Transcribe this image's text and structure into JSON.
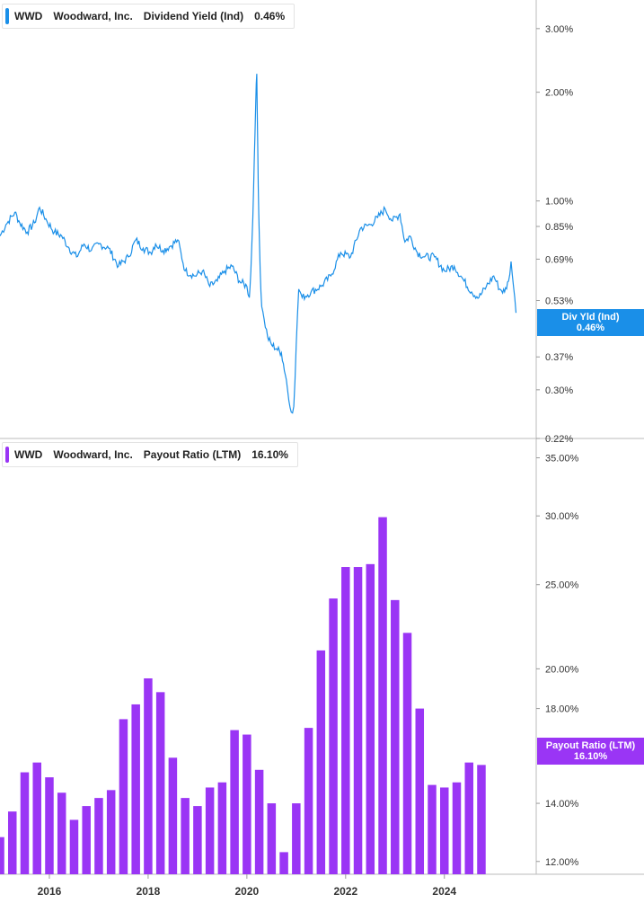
{
  "colors": {
    "yield": "#1a8fe8",
    "payout": "#9a35f5",
    "grid_axis": "#bbbbbb"
  },
  "panels": [
    {
      "legend": {
        "ticker": "WWD",
        "company": "Woodward, Inc.",
        "metric": "Dividend Yield (Ind)",
        "value": "0.46%"
      },
      "flag": {
        "label": "Div Yld (Ind)",
        "value": "0.46%"
      }
    },
    {
      "legend": {
        "ticker": "WWD",
        "company": "Woodward, Inc.",
        "metric": "Payout Ratio (LTM)",
        "value": "16.10%"
      },
      "flag": {
        "label": "Payout Ratio (LTM)",
        "value": "16.10%"
      }
    }
  ],
  "chart_data": [
    {
      "type": "line",
      "scale": "log",
      "ylim": [
        0.22,
        3.6
      ],
      "yticks": [
        3.0,
        2.0,
        1.0,
        0.85,
        0.69,
        0.53,
        0.37,
        0.3,
        0.22
      ],
      "ytick_labels": [
        "3.00%",
        "2.00%",
        "1.00%",
        "0.85%",
        "0.69%",
        "0.53%",
        "0.37%",
        "0.30%",
        "0.22%"
      ],
      "series": [
        {
          "x": [
            2015.0,
            2015.12,
            2015.3,
            2015.4,
            2015.55,
            2015.7,
            2015.8,
            2015.95,
            2016.1,
            2016.25,
            2016.4,
            2016.55,
            2016.7,
            2016.85,
            2017.0,
            2017.2,
            2017.4,
            2017.6,
            2017.75,
            2017.9,
            2018.05,
            2018.15,
            2018.3,
            2018.45,
            2018.6,
            2018.75,
            2018.95,
            2019.1,
            2019.25,
            2019.4,
            2019.55,
            2019.7,
            2019.85,
            2020.0,
            2020.05,
            2020.08,
            2020.12,
            2020.15,
            2020.18,
            2020.2,
            2020.22,
            2020.24,
            2020.27,
            2020.3,
            2020.35,
            2020.42,
            2020.5,
            2020.6,
            2020.7,
            2020.8,
            2020.85,
            2020.9,
            2020.95,
            2021.0,
            2021.05,
            2021.08,
            2021.12,
            2021.3,
            2021.5,
            2021.7,
            2021.9,
            2022.1,
            2022.3,
            2022.5,
            2022.65,
            2022.8,
            2022.95,
            2023.1,
            2023.2,
            2023.3,
            2023.45,
            2023.6,
            2023.8,
            2024.0,
            2024.2,
            2024.4,
            2024.55,
            2024.7,
            2024.85,
            2025.0,
            2025.12,
            2025.22,
            2025.3,
            2025.35,
            2025.4,
            2025.45
          ],
          "y": [
            0.8,
            0.86,
            0.93,
            0.87,
            0.82,
            0.87,
            0.96,
            0.88,
            0.82,
            0.8,
            0.74,
            0.7,
            0.76,
            0.73,
            0.76,
            0.74,
            0.66,
            0.7,
            0.78,
            0.74,
            0.72,
            0.76,
            0.73,
            0.75,
            0.78,
            0.64,
            0.62,
            0.64,
            0.58,
            0.6,
            0.64,
            0.66,
            0.6,
            0.58,
            0.54,
            0.64,
            0.9,
            1.3,
            1.9,
            2.25,
            1.4,
            0.92,
            0.64,
            0.51,
            0.47,
            0.42,
            0.4,
            0.39,
            0.38,
            0.32,
            0.28,
            0.26,
            0.27,
            0.4,
            0.57,
            0.56,
            0.54,
            0.56,
            0.58,
            0.62,
            0.72,
            0.7,
            0.84,
            0.86,
            0.9,
            0.95,
            0.88,
            0.92,
            0.77,
            0.8,
            0.72,
            0.7,
            0.7,
            0.64,
            0.66,
            0.6,
            0.56,
            0.54,
            0.58,
            0.62,
            0.57,
            0.56,
            0.6,
            0.68,
            0.58,
            0.49
          ]
        }
      ]
    },
    {
      "type": "bar",
      "scale": "log",
      "ylim": [
        11.6,
        35.8
      ],
      "yticks": [
        35,
        30,
        25,
        20,
        18,
        14,
        12
      ],
      "ytick_labels": [
        "35.00%",
        "30.00%",
        "25.00%",
        "20.00%",
        "18.00%",
        "14.00%",
        "12.00%"
      ],
      "x": [
        2015.0,
        2015.25,
        2015.5,
        2015.75,
        2016.0,
        2016.25,
        2016.5,
        2016.75,
        2017.0,
        2017.25,
        2017.5,
        2017.75,
        2018.0,
        2018.25,
        2018.5,
        2018.75,
        2019.0,
        2019.25,
        2019.5,
        2019.75,
        2020.0,
        2020.25,
        2020.5,
        2020.75,
        2021.0,
        2021.25,
        2021.5,
        2021.75,
        2022.0,
        2022.25,
        2022.5,
        2022.75,
        2023.0,
        2023.25,
        2023.5,
        2023.75,
        2024.0,
        2024.25,
        2024.5,
        2024.75,
        2025.0,
        2025.25
      ],
      "values": [
        12.8,
        13.7,
        15.2,
        15.6,
        15.0,
        14.4,
        13.4,
        13.9,
        14.2,
        14.5,
        17.5,
        18.2,
        19.5,
        18.8,
        15.8,
        14.2,
        13.9,
        14.6,
        14.8,
        17.0,
        16.8,
        15.3,
        14.0,
        12.3,
        14.0,
        17.1,
        21.0,
        24.1,
        26.2,
        26.2,
        26.4,
        29.9,
        24.0,
        22.0,
        18.0,
        14.7,
        14.6,
        14.8,
        15.6,
        15.5,
        0,
        0
      ],
      "xticks": [
        2016,
        2018,
        2020,
        2022,
        2024
      ],
      "xtick_labels": [
        "2016",
        "2018",
        "2020",
        "2022",
        "2024"
      ]
    }
  ]
}
